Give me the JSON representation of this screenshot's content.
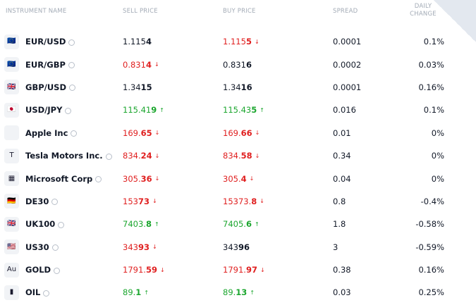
{
  "headers": {
    "name": "INSTRUMENT NAME",
    "sell": "SELL PRICE",
    "buy": "BUY PRICE",
    "spread": "SPREAD",
    "daily_1": "DAILY",
    "daily_2": "CHANGE"
  },
  "colors": {
    "up": "#1ba62e",
    "down": "#e02020",
    "neutral": "#111827",
    "header": "#a3abb6"
  },
  "rows": [
    {
      "name": "EUR/USD",
      "icon": "eu-us-flag-icon",
      "glyph": "🇪🇺",
      "sell_main": "1.115",
      "sell_big": "4",
      "sell_dir": "neutral",
      "buy_main": "1.115",
      "buy_big": "5",
      "buy_dir": "down",
      "spread": "0.0001",
      "change": "0.1%"
    },
    {
      "name": "EUR/GBP",
      "icon": "eu-gb-flag-icon",
      "glyph": "🇪🇺",
      "sell_main": "0.831",
      "sell_big": "4",
      "sell_dir": "down",
      "buy_main": "0.831",
      "buy_big": "6",
      "buy_dir": "neutral",
      "spread": "0.0002",
      "change": "0.03%"
    },
    {
      "name": "GBP/USD",
      "icon": "gb-us-flag-icon",
      "glyph": "🇬🇧",
      "sell_main": "1.34",
      "sell_big": "15",
      "sell_dir": "neutral",
      "buy_main": "1.34",
      "buy_big": "16",
      "buy_dir": "neutral",
      "spread": "0.0001",
      "change": "0.16%"
    },
    {
      "name": "USD/JPY",
      "icon": "us-jp-flag-icon",
      "glyph": "🇯🇵",
      "sell_main": "115.41",
      "sell_big": "9",
      "sell_dir": "up",
      "buy_main": "115.43",
      "buy_big": "5",
      "buy_dir": "up",
      "spread": "0.016",
      "change": "0.1%"
    },
    {
      "name": "Apple Inc",
      "icon": "apple-logo-icon",
      "glyph": "",
      "sell_main": "169.",
      "sell_big": "65",
      "sell_dir": "down",
      "buy_main": "169.",
      "buy_big": "66",
      "buy_dir": "down",
      "spread": "0.01",
      "change": "0%"
    },
    {
      "name": "Tesla Motors Inc.",
      "icon": "tesla-logo-icon",
      "glyph": "T",
      "sell_main": "834.",
      "sell_big": "24",
      "sell_dir": "down",
      "buy_main": "834.",
      "buy_big": "58",
      "buy_dir": "down",
      "spread": "0.34",
      "change": "0%"
    },
    {
      "name": "Microsoft Corp",
      "icon": "microsoft-logo-icon",
      "glyph": "▦",
      "sell_main": "305.",
      "sell_big": "36",
      "sell_dir": "down",
      "buy_main": "305.",
      "buy_big": "4",
      "buy_dir": "down",
      "spread": "0.04",
      "change": "0%"
    },
    {
      "name": "DE30",
      "icon": "germany-flag-icon",
      "glyph": "🇩🇪",
      "sell_main": "153",
      "sell_big": "73",
      "sell_dir": "down",
      "buy_main": "15373.",
      "buy_big": "8",
      "buy_dir": "down",
      "spread": "0.8",
      "change": "-0.4%"
    },
    {
      "name": "UK100",
      "icon": "uk-flag-icon",
      "glyph": "🇬🇧",
      "sell_main": "7403.",
      "sell_big": "8",
      "sell_dir": "up",
      "buy_main": "7405.",
      "buy_big": "6",
      "buy_dir": "up",
      "spread": "1.8",
      "change": "-0.58%"
    },
    {
      "name": "US30",
      "icon": "us-flag-icon",
      "glyph": "🇺🇸",
      "sell_main": "343",
      "sell_big": "93",
      "sell_dir": "down",
      "buy_main": "343",
      "buy_big": "96",
      "buy_dir": "neutral",
      "spread": "3",
      "change": "-0.59%"
    },
    {
      "name": "GOLD",
      "icon": "gold-bar-icon",
      "glyph": "Au",
      "sell_main": "1791.",
      "sell_big": "59",
      "sell_dir": "down",
      "buy_main": "1791.",
      "buy_big": "97",
      "buy_dir": "down",
      "spread": "0.38",
      "change": "0.16%"
    },
    {
      "name": "OIL",
      "icon": "oil-barrel-icon",
      "glyph": "▮",
      "sell_main": "89.",
      "sell_big": "1",
      "sell_dir": "up",
      "buy_main": "89.",
      "buy_big": "13",
      "buy_dir": "up",
      "spread": "0.03",
      "change": "0.25%"
    }
  ]
}
